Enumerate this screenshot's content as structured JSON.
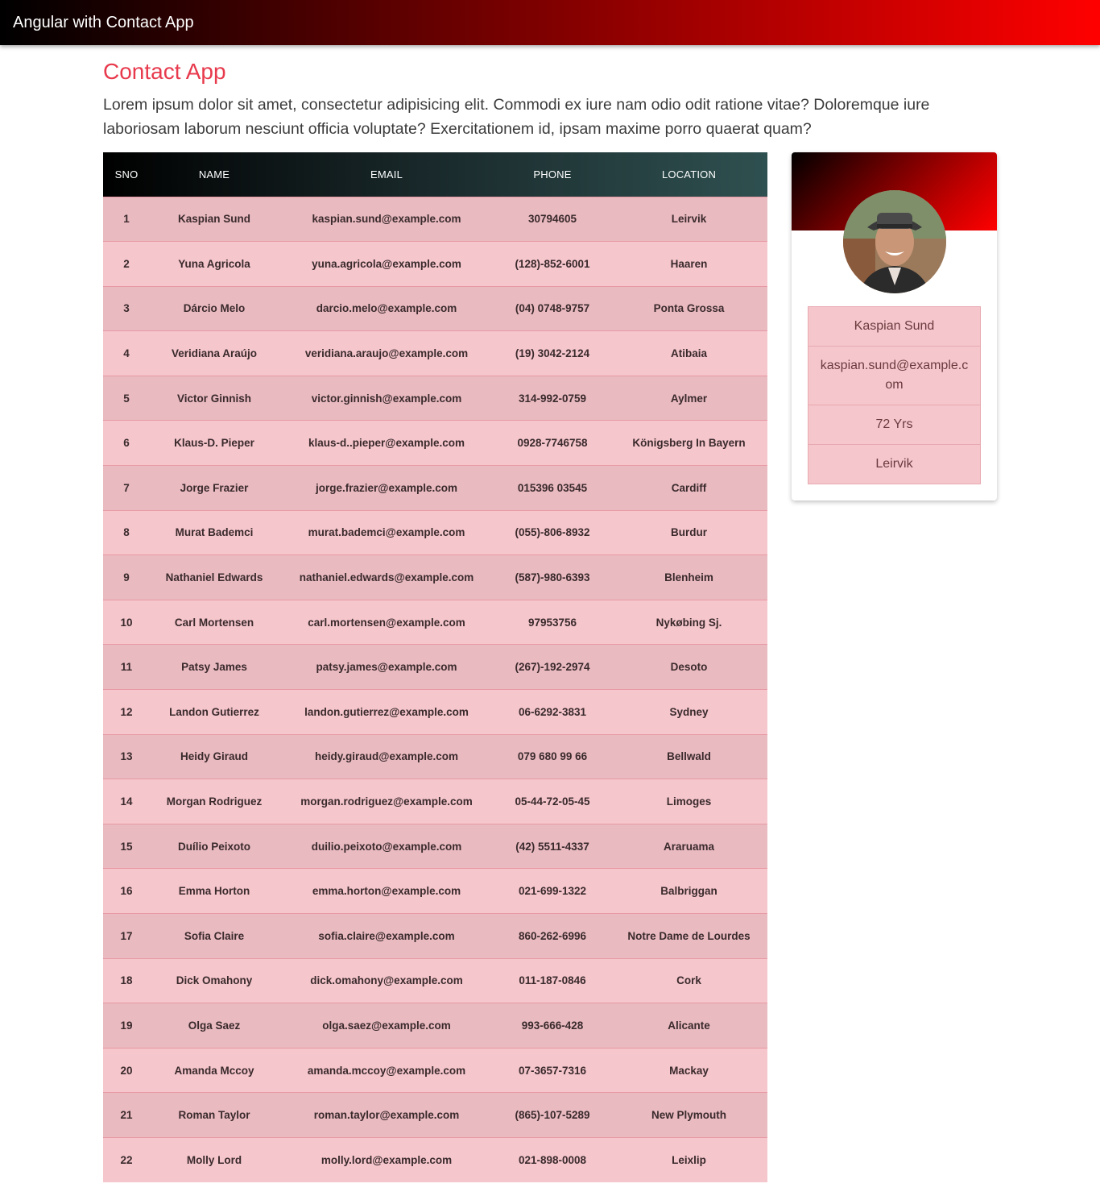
{
  "navbar": {
    "brand": "Angular with Contact App"
  },
  "page": {
    "title": "Contact App",
    "lead": "Lorem ipsum dolor sit amet, consectetur adipisicing elit. Commodi ex iure nam odio odit ratione vitae? Doloremque iure laboriosam laborum nesciunt officia voluptate? Exercitationem id, ipsam maxime porro quaerat quam?"
  },
  "table": {
    "headers": [
      "SNO",
      "NAME",
      "EMAIL",
      "PHONE",
      "LOCATION"
    ],
    "rows": [
      [
        "1",
        "Kaspian Sund",
        "kaspian.sund@example.com",
        "30794605",
        "Leirvik"
      ],
      [
        "2",
        "Yuna Agricola",
        "yuna.agricola@example.com",
        "(128)-852-6001",
        "Haaren"
      ],
      [
        "3",
        "Dárcio Melo",
        "darcio.melo@example.com",
        "(04) 0748-9757",
        "Ponta Grossa"
      ],
      [
        "4",
        "Veridiana Araújo",
        "veridiana.araujo@example.com",
        "(19) 3042-2124",
        "Atibaia"
      ],
      [
        "5",
        "Victor Ginnish",
        "victor.ginnish@example.com",
        "314-992-0759",
        "Aylmer"
      ],
      [
        "6",
        "Klaus-D. Pieper",
        "klaus-d..pieper@example.com",
        "0928-7746758",
        "Königsberg In Bayern"
      ],
      [
        "7",
        "Jorge Frazier",
        "jorge.frazier@example.com",
        "015396 03545",
        "Cardiff"
      ],
      [
        "8",
        "Murat Bademci",
        "murat.bademci@example.com",
        "(055)-806-8932",
        "Burdur"
      ],
      [
        "9",
        "Nathaniel Edwards",
        "nathaniel.edwards@example.com",
        "(587)-980-6393",
        "Blenheim"
      ],
      [
        "10",
        "Carl Mortensen",
        "carl.mortensen@example.com",
        "97953756",
        "Nykøbing Sj."
      ],
      [
        "11",
        "Patsy James",
        "patsy.james@example.com",
        "(267)-192-2974",
        "Desoto"
      ],
      [
        "12",
        "Landon Gutierrez",
        "landon.gutierrez@example.com",
        "06-6292-3831",
        "Sydney"
      ],
      [
        "13",
        "Heidy Giraud",
        "heidy.giraud@example.com",
        "079 680 99 66",
        "Bellwald"
      ],
      [
        "14",
        "Morgan Rodriguez",
        "morgan.rodriguez@example.com",
        "05-44-72-05-45",
        "Limoges"
      ],
      [
        "15",
        "Duílio Peixoto",
        "duilio.peixoto@example.com",
        "(42) 5511-4337",
        "Araruama"
      ],
      [
        "16",
        "Emma Horton",
        "emma.horton@example.com",
        "021-699-1322",
        "Balbriggan"
      ],
      [
        "17",
        "Sofia Claire",
        "sofia.claire@example.com",
        "860-262-6996",
        "Notre Dame de Lourdes"
      ],
      [
        "18",
        "Dick Omahony",
        "dick.omahony@example.com",
        "011-187-0846",
        "Cork"
      ],
      [
        "19",
        "Olga Saez",
        "olga.saez@example.com",
        "993-666-428",
        "Alicante"
      ],
      [
        "20",
        "Amanda Mccoy",
        "amanda.mccoy@example.com",
        "07-3657-7316",
        "Mackay"
      ],
      [
        "21",
        "Roman Taylor",
        "roman.taylor@example.com",
        "(865)-107-5289",
        "New Plymouth"
      ],
      [
        "22",
        "Molly Lord",
        "molly.lord@example.com",
        "021-898-0008",
        "Leixlip"
      ]
    ]
  },
  "profile": {
    "name": "Kaspian Sund",
    "email": "kaspian.sund@example.com",
    "age": "72 Yrs",
    "location": "Leirvik"
  },
  "colors": {
    "title_accent": "#e83a4d",
    "row_odd": "#e9bac0",
    "row_even": "#f5c6cc"
  }
}
